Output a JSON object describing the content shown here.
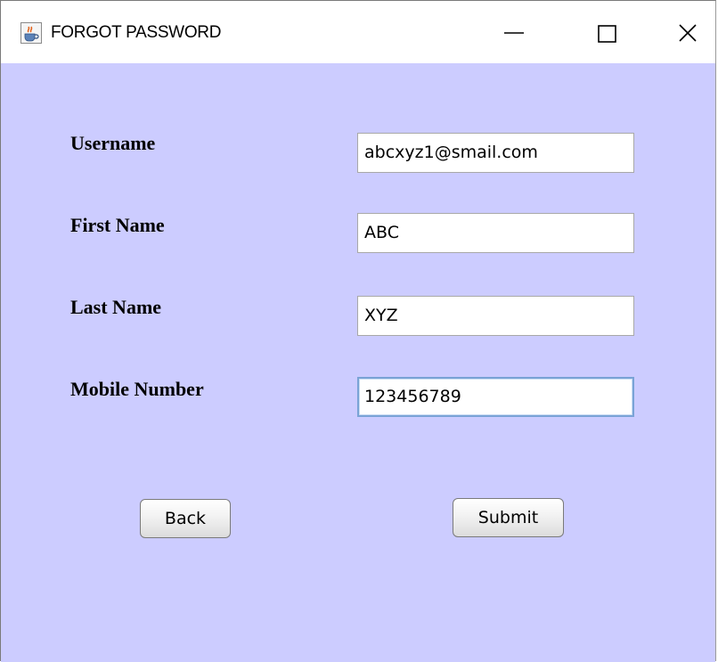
{
  "window": {
    "title": "FORGOT PASSWORD",
    "icon": "java-cup-icon",
    "controls": [
      "minimize-icon",
      "maximize-icon",
      "close-icon"
    ]
  },
  "form": {
    "background_color": "#ccccff",
    "fields": [
      {
        "label": "Username",
        "value": "abcxyz1@smail.com"
      },
      {
        "label": "First Name",
        "value": "ABC"
      },
      {
        "label": "Last Name",
        "value": "XYZ"
      },
      {
        "label": "Mobile Number",
        "value": "123456789"
      }
    ]
  },
  "buttons": {
    "back_label": "Back",
    "submit_label": "Submit"
  }
}
